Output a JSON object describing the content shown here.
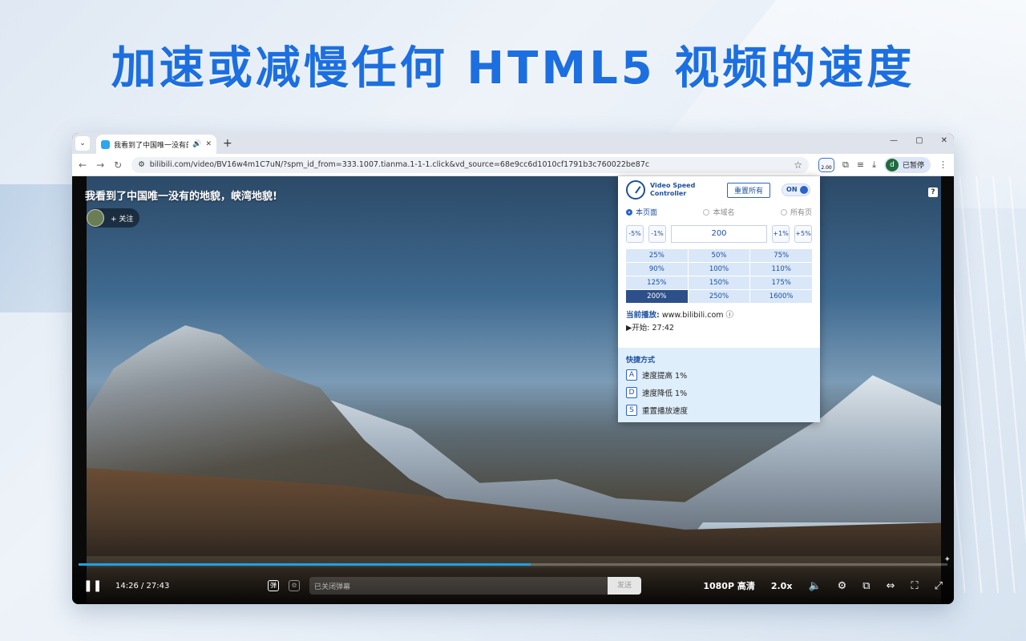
{
  "headline": "加速或减慢任何 HTML5 视频的速度",
  "browser": {
    "tab_title": "我看到了中国唯一没有的地",
    "new_tab": "+",
    "url": "bilibili.com/video/BV16w4m1C7uN/?spm_id_from=333.1007.tianma.1-1-1.click&vd_source=68e9cc6d1010cf1791b3c760022be87c",
    "ext_badge": "2.00",
    "profile_initial": "d",
    "profile_label": "已暂停"
  },
  "video": {
    "title": "我看到了中国唯一没有的地貌，峡湾地貌!",
    "follow_label": "+ 关注",
    "time": "14:26 / 27:43",
    "progress": 0.52,
    "danmaku_placeholder": "已关闭弹幕",
    "send_label": "发送",
    "quality": "1080P 高清",
    "speed": "2.0x"
  },
  "vsc": {
    "name": "Video Speed Controller",
    "reset_all": "重置所有",
    "toggle": "ON",
    "scopes": [
      "本页面",
      "本域名",
      "所有页"
    ],
    "adjust": [
      "-5%",
      "-1%",
      "+1%",
      "+5%"
    ],
    "speed_value": "200",
    "presets": [
      "25%",
      "50%",
      "75%",
      "90%",
      "100%",
      "110%",
      "125%",
      "150%",
      "175%",
      "200%",
      "250%",
      "1600%"
    ],
    "active_preset": "200%",
    "now_playing_label": "当前播放:",
    "now_playing_site": "www.bilibili.com",
    "start_label": "▶开始:",
    "start_time": "27:42",
    "shortcuts_label": "快捷方式",
    "shortcuts": [
      {
        "key": "A",
        "desc": "速度提高 1%"
      },
      {
        "key": "D",
        "desc": "速度降低 1%"
      },
      {
        "key": "S",
        "desc": "重置播放速度"
      }
    ]
  }
}
